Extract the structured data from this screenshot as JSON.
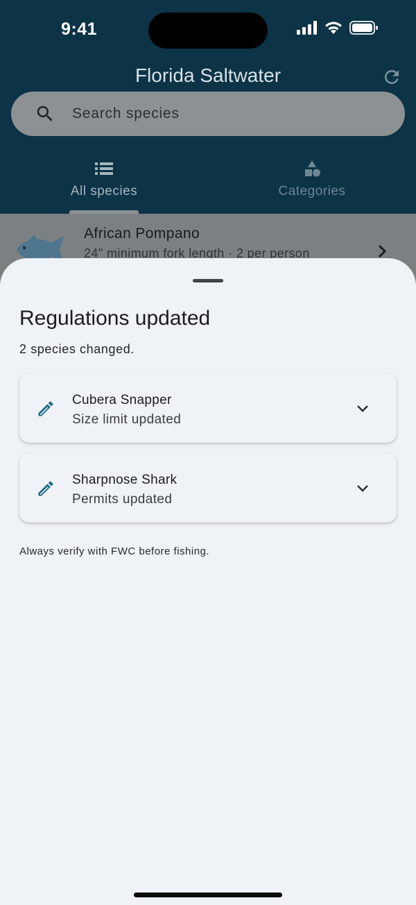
{
  "status_bar": {
    "time": "9:41",
    "icons": [
      "cellular-signal-icon",
      "wifi-icon",
      "battery-icon"
    ]
  },
  "header": {
    "title": "Florida Saltwater",
    "refresh_icon": "refresh-icon",
    "search": {
      "placeholder": "Search species",
      "icon": "search-icon"
    },
    "tabs": [
      {
        "label": "All species",
        "icon": "list-icon",
        "selected": true
      },
      {
        "label": "Categories",
        "icon": "shapes-icon",
        "selected": false
      }
    ]
  },
  "list": {
    "rows": [
      {
        "title": "African Pompano",
        "subtitle": "24\" minimum fork length · 2 per person",
        "icon": "fish-thumbnail"
      }
    ]
  },
  "sheet": {
    "title": "Regulations updated",
    "subtitle": "2 species changed.",
    "changes": [
      {
        "species": "Cubera Snapper",
        "change": "Size limit updated",
        "icon": "edit-icon"
      },
      {
        "species": "Sharpnose Shark",
        "change": "Permits updated",
        "icon": "edit-icon"
      }
    ],
    "footer": "Always verify with FWC before fishing."
  },
  "colors": {
    "header_bg": "#0c3346",
    "sheet_bg": "#eff2f7",
    "accent": "#1f6a86"
  }
}
